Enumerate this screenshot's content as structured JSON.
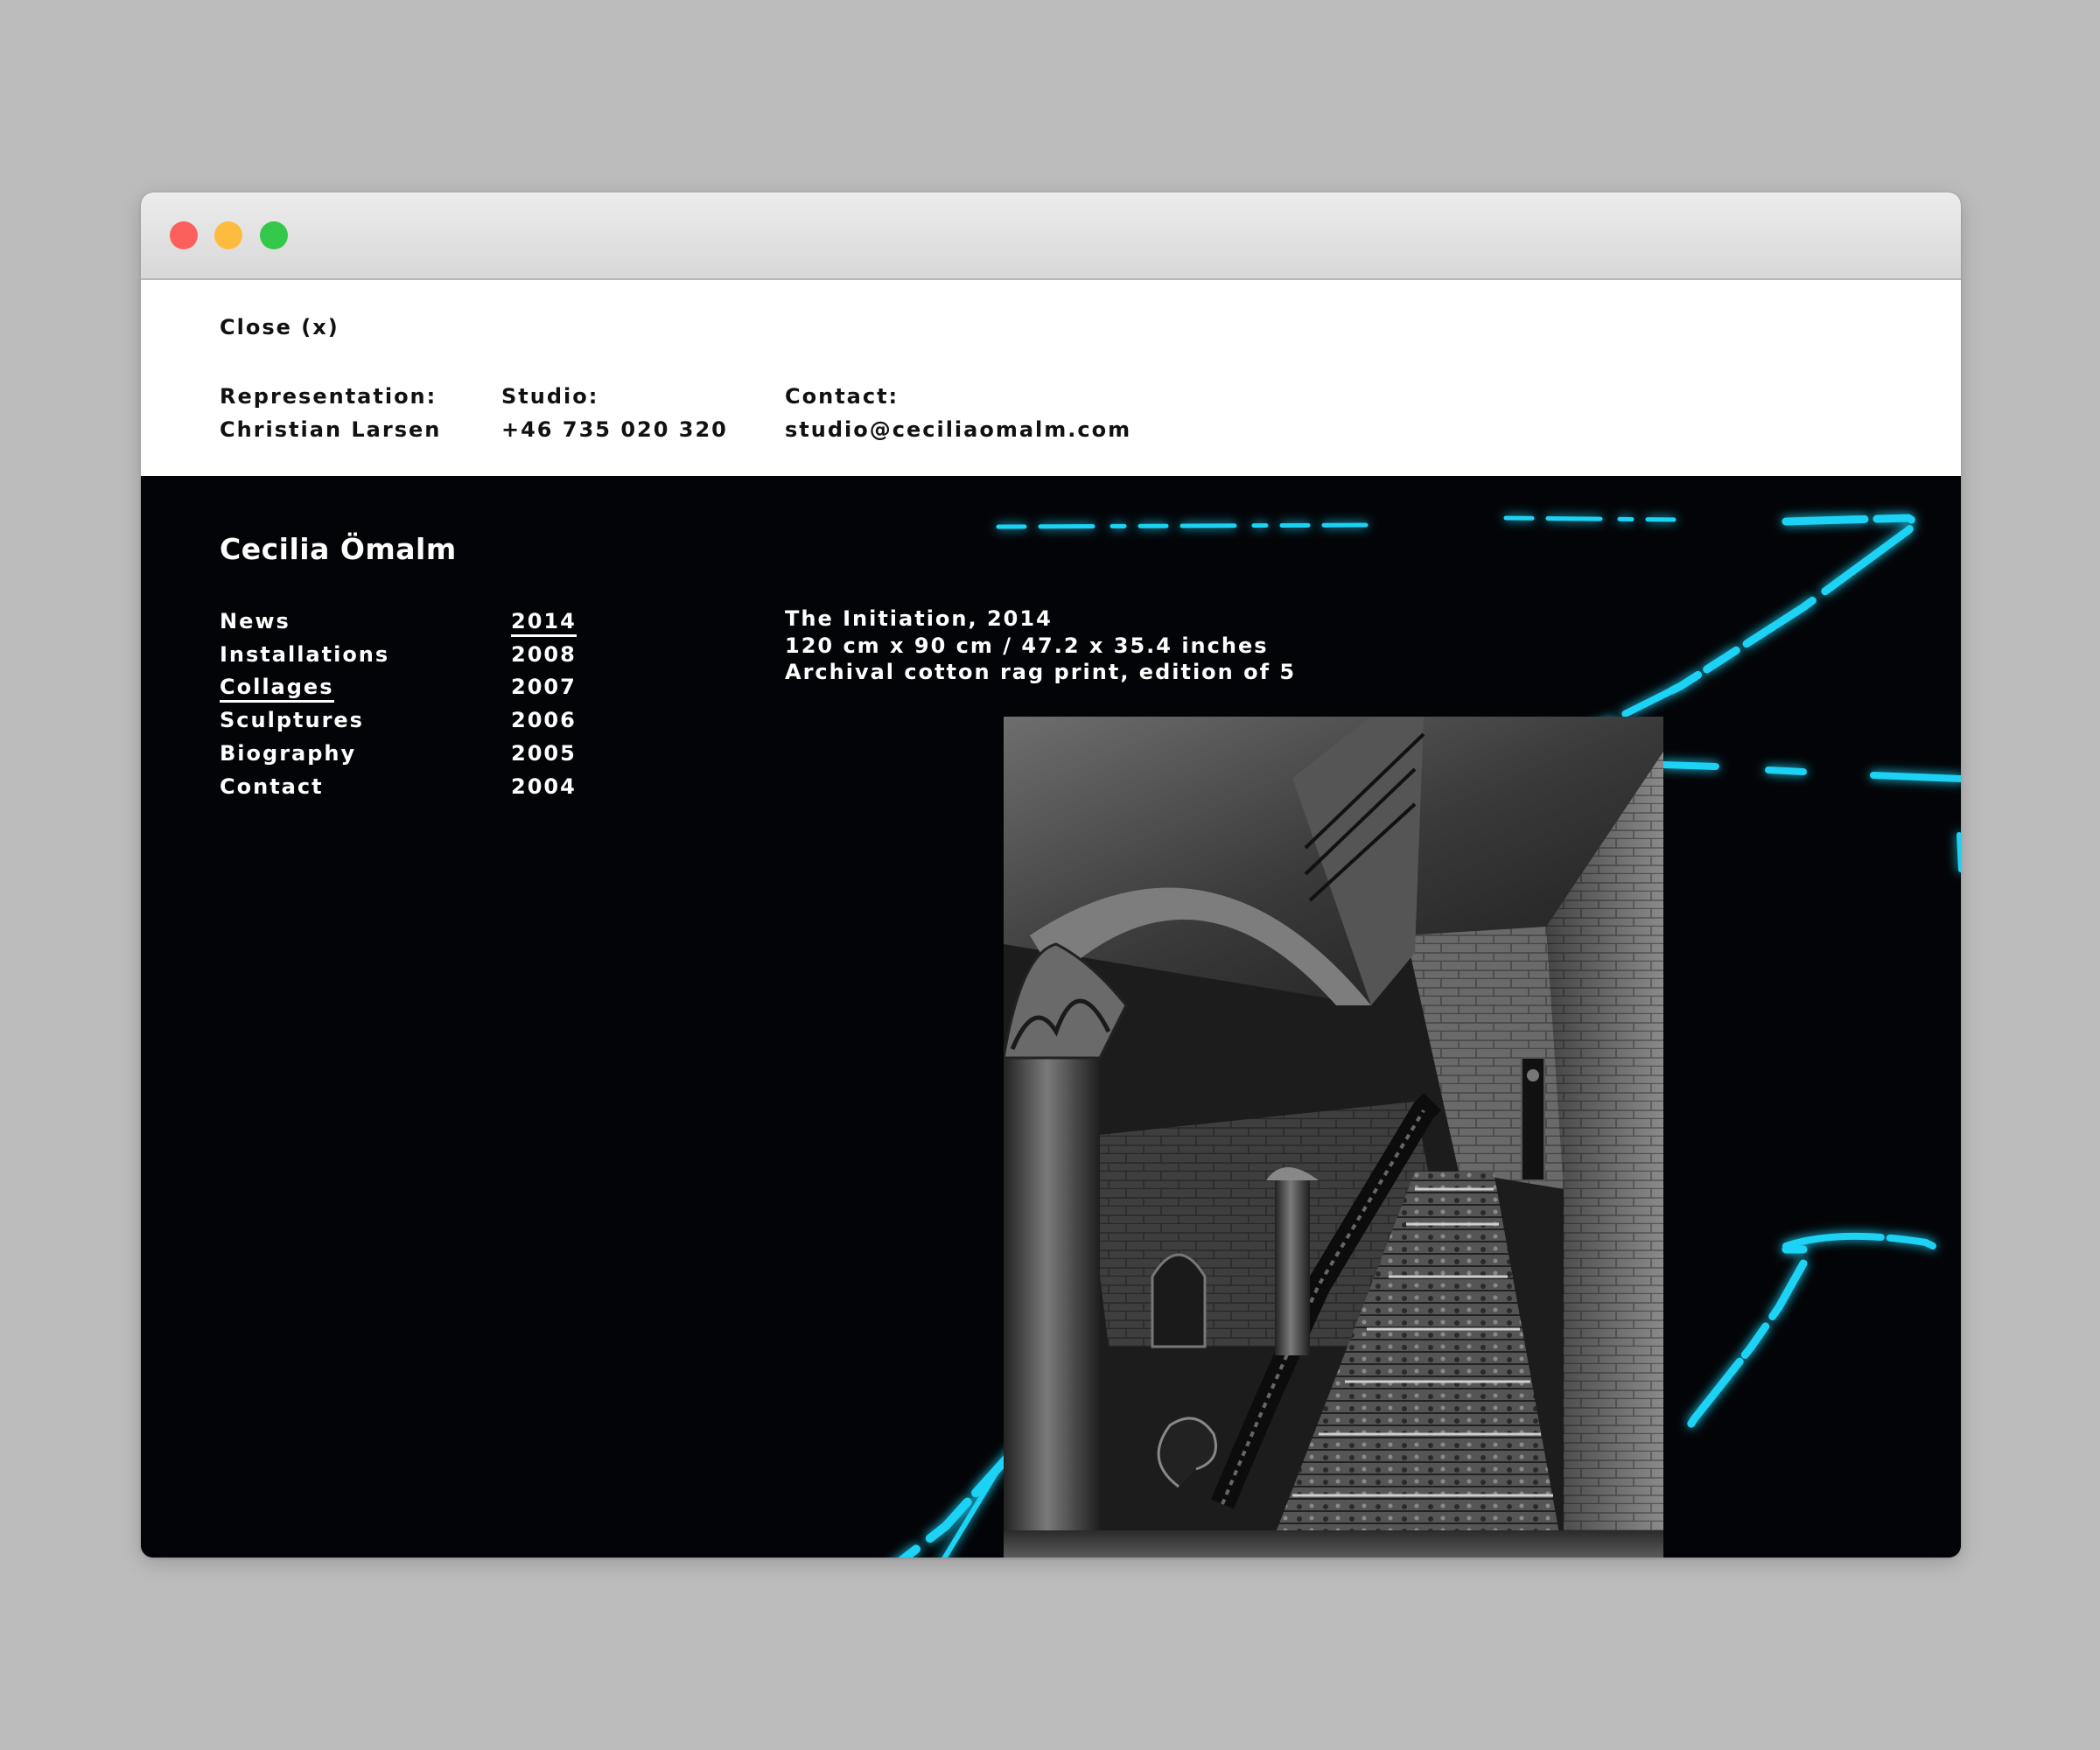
{
  "window": {
    "traffic_lights": {
      "close_color": "#fc605c",
      "minimize_color": "#fdbc40",
      "zoom_color": "#34c84a"
    }
  },
  "info_panel": {
    "close_label": "Close (x)",
    "representation": {
      "label": "Representation:",
      "value": "Christian Larsen"
    },
    "studio": {
      "label": "Studio:",
      "value": "+46 735 020 320"
    },
    "contact": {
      "label": "Contact:",
      "value": "studio@ceciliaomalm.com"
    }
  },
  "site": {
    "title": "Cecilia Ömalm",
    "accent_color": "#1ad3f5"
  },
  "nav": {
    "items": [
      {
        "label": "News",
        "active": false
      },
      {
        "label": "Installations",
        "active": false
      },
      {
        "label": "Collages",
        "active": true
      },
      {
        "label": "Sculptures",
        "active": false
      },
      {
        "label": "Biography",
        "active": false
      },
      {
        "label": "Contact",
        "active": false
      }
    ]
  },
  "years": {
    "items": [
      {
        "label": "2014",
        "active": true
      },
      {
        "label": "2008",
        "active": false
      },
      {
        "label": "2007",
        "active": false
      },
      {
        "label": "2006",
        "active": false
      },
      {
        "label": "2005",
        "active": false
      },
      {
        "label": "2004",
        "active": false
      }
    ]
  },
  "artwork": {
    "title_line": "The Initiation, 2014",
    "dimensions_line": "120 cm x 90 cm / 47.2 x 35.4 inches",
    "medium_line": "Archival cotton rag print, edition of 5",
    "icon": "staircase-photo-icon"
  }
}
